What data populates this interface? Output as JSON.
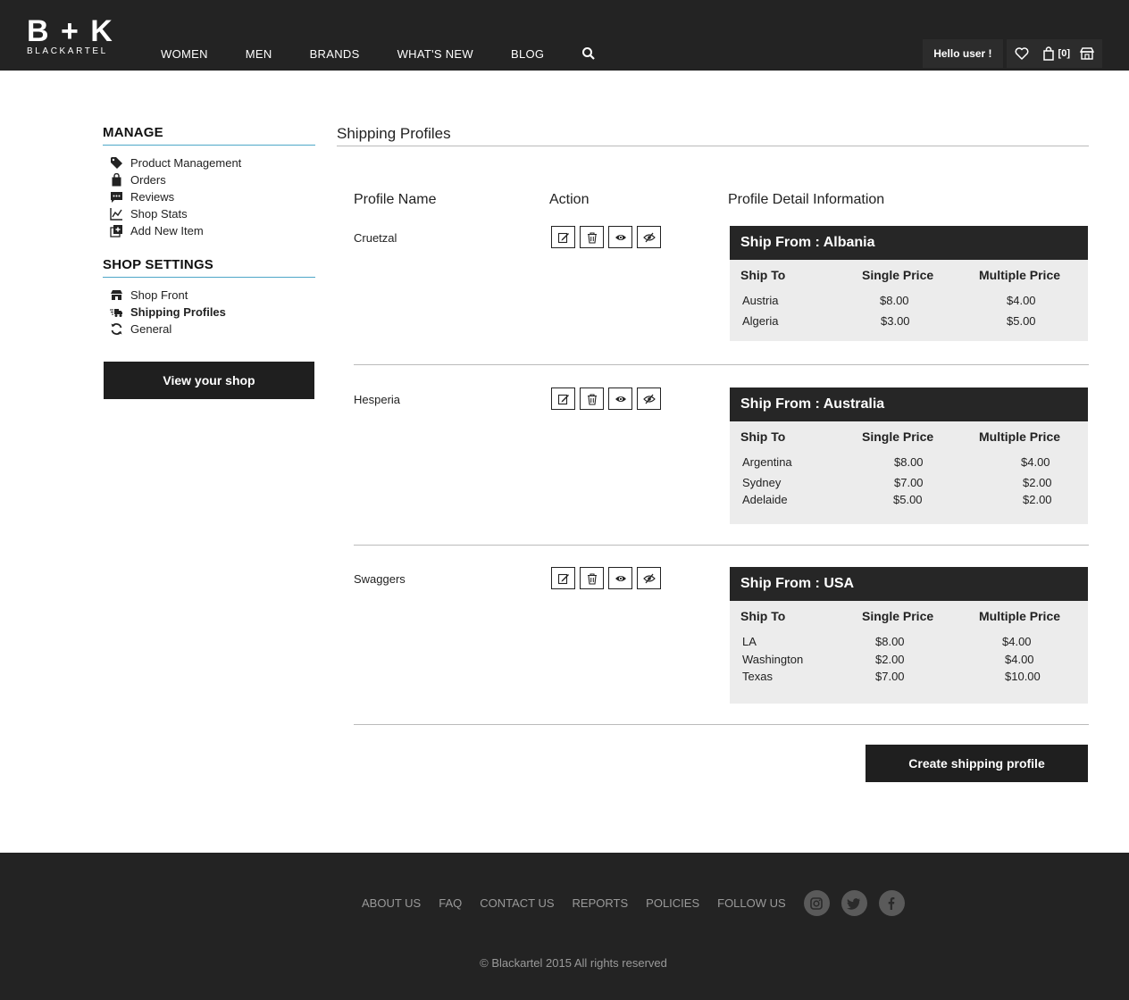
{
  "header": {
    "logo_mark": "B + K",
    "logo_word": "BLACKARTEL",
    "nav": [
      "WOMEN",
      "MEN",
      "BRANDS",
      "WHAT'S NEW",
      "BLOG"
    ],
    "greeting": "Hello user !",
    "cart_count": "[0]",
    "icons": [
      "search-icon",
      "heart-icon",
      "bag-icon",
      "shop-icon"
    ]
  },
  "sidebar": {
    "manage_heading": "MANAGE",
    "manage_items": [
      {
        "label": "Product Management",
        "icon": "tag-icon"
      },
      {
        "label": "Orders",
        "icon": "bag-icon"
      },
      {
        "label": "Reviews",
        "icon": "comment-icon"
      },
      {
        "label": "Shop Stats",
        "icon": "chart-icon"
      },
      {
        "label": "Add New Item",
        "icon": "add-icon"
      }
    ],
    "settings_heading": "SHOP SETTINGS",
    "settings_items": [
      {
        "label": "Shop Front",
        "icon": "storefront-icon"
      },
      {
        "label": "Shipping Profiles",
        "icon": "truck-icon",
        "active": true
      },
      {
        "label": "General",
        "icon": "refresh-icon"
      }
    ],
    "view_shop": "View your shop"
  },
  "main": {
    "title": "Shipping Profiles",
    "col_name": "Profile Name",
    "col_action": "Action",
    "col_detail": "Profile Detail Information",
    "card_cols": {
      "ship_to": "Ship To",
      "single": "Single Price",
      "multiple": "Multiple Price"
    },
    "profiles": [
      {
        "name": "Cruetzal",
        "ship_from": "Ship From : Albania",
        "rows": [
          {
            "to": "Austria",
            "single": "$8.00",
            "multiple": "$4.00"
          },
          {
            "to": "Algeria",
            "single": "$3.00",
            "multiple": "$5.00"
          }
        ]
      },
      {
        "name": "Hesperia",
        "ship_from": "Ship From : Australia",
        "rows": [
          {
            "to": "Argentina",
            "single": "$8.00",
            "multiple": "$4.00"
          },
          {
            "to": "Sydney",
            "single": "$7.00",
            "multiple": "$2.00"
          },
          {
            "to": "Adelaide",
            "single": "$5.00",
            "multiple": "$2.00"
          }
        ]
      },
      {
        "name": "Swaggers",
        "ship_from": "Ship From : USA",
        "rows": [
          {
            "to": "LA",
            "single": "$8.00",
            "multiple": "$4.00"
          },
          {
            "to": "Washington",
            "single": "$2.00",
            "multiple": "$4.00"
          },
          {
            "to": "Texas",
            "single": "$7.00",
            "multiple": "$10.00"
          }
        ]
      }
    ],
    "create_button": "Create shipping profile"
  },
  "footer": {
    "links": [
      "ABOUT US",
      "FAQ",
      "CONTACT US",
      "REPORTS",
      "POLICIES",
      "FOLLOW US"
    ],
    "social": [
      "instagram-icon",
      "twitter-icon",
      "facebook-icon"
    ],
    "copyright": "© Blackartel 2015 All rights reserved"
  }
}
